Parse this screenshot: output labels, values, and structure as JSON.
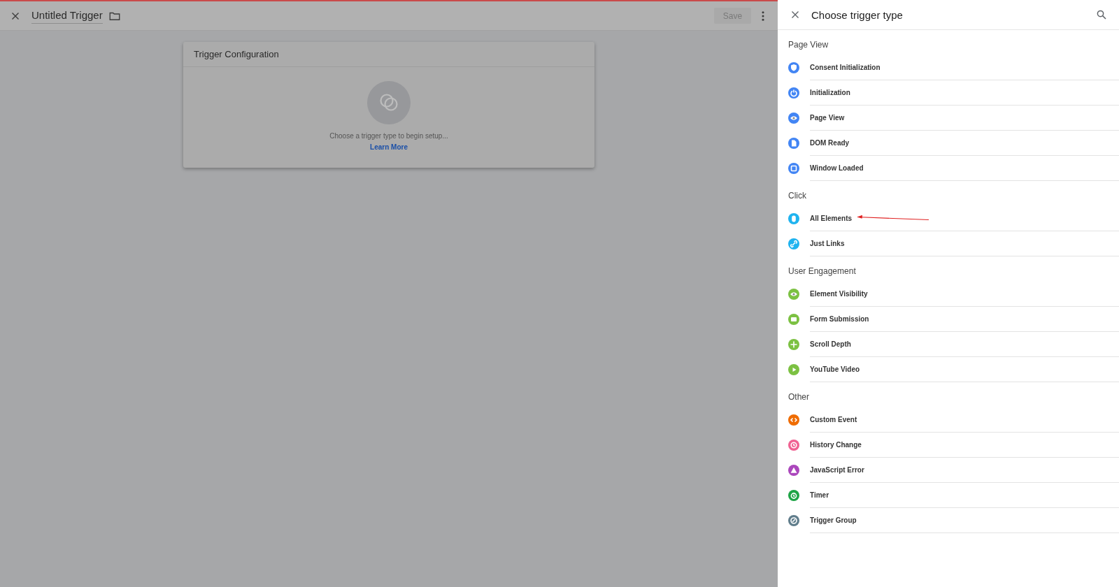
{
  "editor": {
    "title": "Untitled Trigger",
    "save_button": "Save",
    "disabled_save": true
  },
  "card": {
    "title": "Trigger Configuration",
    "message": "Choose a trigger type to begin setup...",
    "link": "Learn More"
  },
  "panel": {
    "title": "Choose trigger type",
    "sections": [
      {
        "heading": "Page View",
        "items": [
          {
            "label": "Consent Initialization",
            "color": "#4285f4",
            "annotated": false
          },
          {
            "label": "Initialization",
            "color": "#4285f4",
            "annotated": false
          },
          {
            "label": "Page View",
            "color": "#4285f4",
            "annotated": false
          },
          {
            "label": "DOM Ready",
            "color": "#4285f4",
            "annotated": false
          },
          {
            "label": "Window Loaded",
            "color": "#4285f4",
            "annotated": false
          }
        ]
      },
      {
        "heading": "Click",
        "items": [
          {
            "label": "All Elements",
            "color": "#1fb3ef",
            "annotated": true
          },
          {
            "label": "Just Links",
            "color": "#1fb3ef",
            "annotated": false
          }
        ]
      },
      {
        "heading": "User Engagement",
        "items": [
          {
            "label": "Element Visibility",
            "color": "#7cc142",
            "annotated": false
          },
          {
            "label": "Form Submission",
            "color": "#7cc142",
            "annotated": false
          },
          {
            "label": "Scroll Depth",
            "color": "#7cc142",
            "annotated": false
          },
          {
            "label": "YouTube Video",
            "color": "#7cc142",
            "annotated": false
          }
        ]
      },
      {
        "heading": "Other",
        "items": [
          {
            "label": "Custom Event",
            "color": "#ef6c00",
            "annotated": false
          },
          {
            "label": "History Change",
            "color": "#f06292",
            "annotated": false
          },
          {
            "label": "JavaScript Error",
            "color": "#ab47bc",
            "annotated": false
          },
          {
            "label": "Timer",
            "color": "#1ea446",
            "annotated": false
          },
          {
            "label": "Trigger Group",
            "color": "#607d8b",
            "annotated": false
          }
        ]
      }
    ]
  }
}
